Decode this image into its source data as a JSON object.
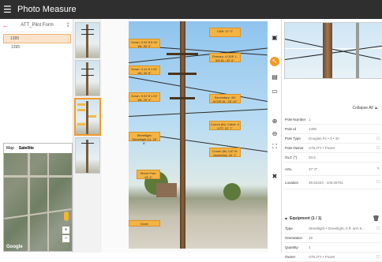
{
  "app": {
    "title": "Photo Measure"
  },
  "form": {
    "name": "ATT_Pilot Form"
  },
  "items": [
    "1395",
    "1395"
  ],
  "map": {
    "tabs": [
      "Map",
      "Satellite"
    ],
    "attribution": "Google"
  },
  "labels": [
    "Down: 5.92 ft 5.94' Wt: 35' 0\"",
    "CAB: 37' 0\"",
    "Down: 4.14 ft 1.51' Wt: 33' 8\"",
    "Primary: 4-0DE 1-8/0 AL: 32' 6\"",
    "Down: 5.92 ft 1.52' Wt: 29' 4\"",
    "Secondary: 4/0 ACSR AL: 26' 10\"",
    "Streetlight: Streetlight (1): 25' 8\"",
    "Comm (fb): Cable: 4 UTT: 22' 7\"",
    "Comm (fb) CAT Ill: Assembly: 20' 1\"",
    "Street Pole: 15' 4\"",
    "Down"
  ],
  "panel": {
    "collapse": "Collapse All",
    "fields": [
      {
        "k": "Pole Number",
        "v": "1"
      },
      {
        "k": "Pole Id",
        "v": "1395"
      },
      {
        "k": "Pole Type",
        "v": "Douglas Fir • 4 • 40"
      },
      {
        "k": "Pole Owner",
        "v": "UTILITY • Power"
      },
      {
        "k": "GLC (\")",
        "v": "33.5"
      },
      {
        "k": "AGL",
        "v": "37' 0\""
      },
      {
        "k": "Location",
        "v": "39.52423, -105.08761"
      }
    ],
    "equipment": {
      "title": "Equipment (1 / 1)",
      "fields": [
        {
          "k": "Type",
          "v": "Streetlight • Streetlight, 6 ft. arm 6..."
        },
        {
          "k": "Orientation",
          "v": "16"
        },
        {
          "k": "Quantity",
          "v": "1"
        },
        {
          "k": "Owner",
          "v": "UTILITY • Power"
        }
      ]
    }
  }
}
